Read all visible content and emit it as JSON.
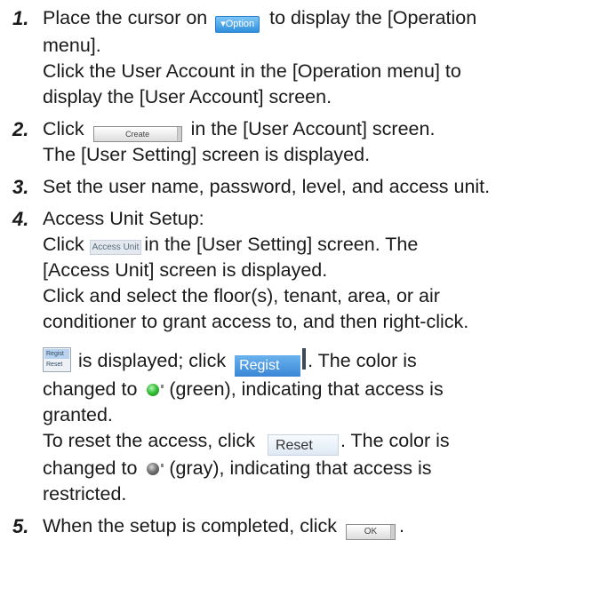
{
  "steps": [
    {
      "num": "1.",
      "l1a": "Place the cursor on",
      "option_label": "▾Option",
      "l1b": "to display the [Operation",
      "l2": "menu].",
      "l3": "Click the User Account in the [Operation menu] to",
      "l4": "display the [User Account] screen."
    },
    {
      "num": "2.",
      "l1a": "Click",
      "create_label": "Create",
      "l1b": "in the [User Account] screen.",
      "l2": "The [User Setting] screen is displayed."
    },
    {
      "num": "3.",
      "l1": "Set the user name, password, level, and access unit."
    },
    {
      "num": "4.",
      "l1": "Access Unit Setup:",
      "l2a": "Click",
      "access_unit_label": "Access Unit",
      "l2b": "in the [User Setting] screen. The",
      "l3": "[Access Unit] screen is displayed.",
      "l4": "Click and select the floor(s), tenant, area, or air",
      "l5": "conditioner to grant access to, and then right-click.",
      "menu_regist": "Regist",
      "menu_reset": "Reset",
      "p1a": "is displayed; click",
      "regist_label": "Regist",
      "p1b": ". The color is",
      "p2a": "changed to",
      "p2b": "(green), indicating that access is",
      "p3": "granted.",
      "p4a": "To reset the access, click",
      "reset_label": "Reset",
      "p4b": ". The color is",
      "p5a": "changed to",
      "p5b": "(gray), indicating that access is",
      "p6": "restricted."
    },
    {
      "num": "5.",
      "l1a": "When the setup is completed, click",
      "ok_label": "OK",
      "l1b": "."
    }
  ]
}
